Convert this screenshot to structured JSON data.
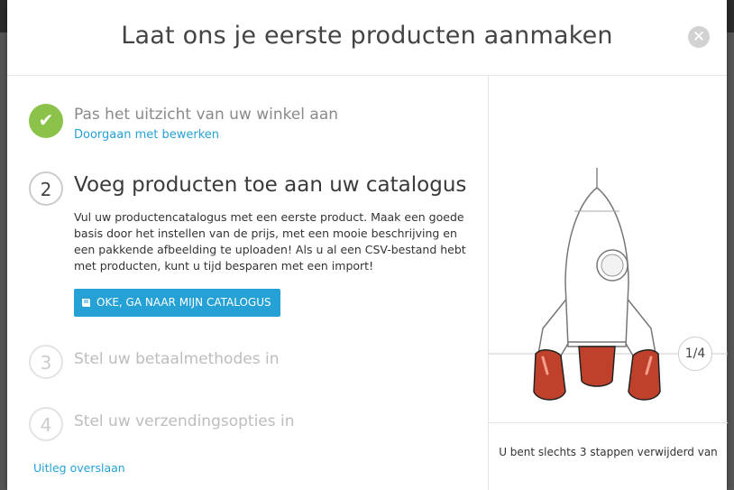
{
  "modal": {
    "title": "Laat ons je eerste producten aanmaken",
    "close_icon": "close-icon"
  },
  "steps": [
    {
      "number": "✔",
      "title": "Pas het uitzicht van uw winkel aan",
      "link": "Doorgaan met bewerken",
      "state": "done"
    },
    {
      "number": "2",
      "title": "Voeg producten toe aan uw catalogus",
      "description": "Vul uw productencatalogus met een eerste product. Maak een goede basis door het instellen van de prijs, met een mooie beschrijving en een pakkende afbeelding te uploaden! Als u al een CSV-bestand hebt met producten, kunt u tijd besparen met een import!",
      "button": "OKE, GA NAAR MIJN CATALOGUS",
      "button_icon": "book-icon",
      "state": "active"
    },
    {
      "number": "3",
      "title": "Stel uw betaalmethodes in",
      "state": "todo"
    },
    {
      "number": "4",
      "title": "Stel uw verzendingsopties in",
      "state": "todo"
    }
  ],
  "skip_link": "Uitleg overslaan",
  "progress": {
    "label": "1/4",
    "current": 1,
    "total": 4
  },
  "footer": "U bent slechts 3 stappen verwijderd van",
  "colors": {
    "accent": "#25a1d6",
    "done": "#8bc34a",
    "rocket_fill": "#c0412b"
  }
}
